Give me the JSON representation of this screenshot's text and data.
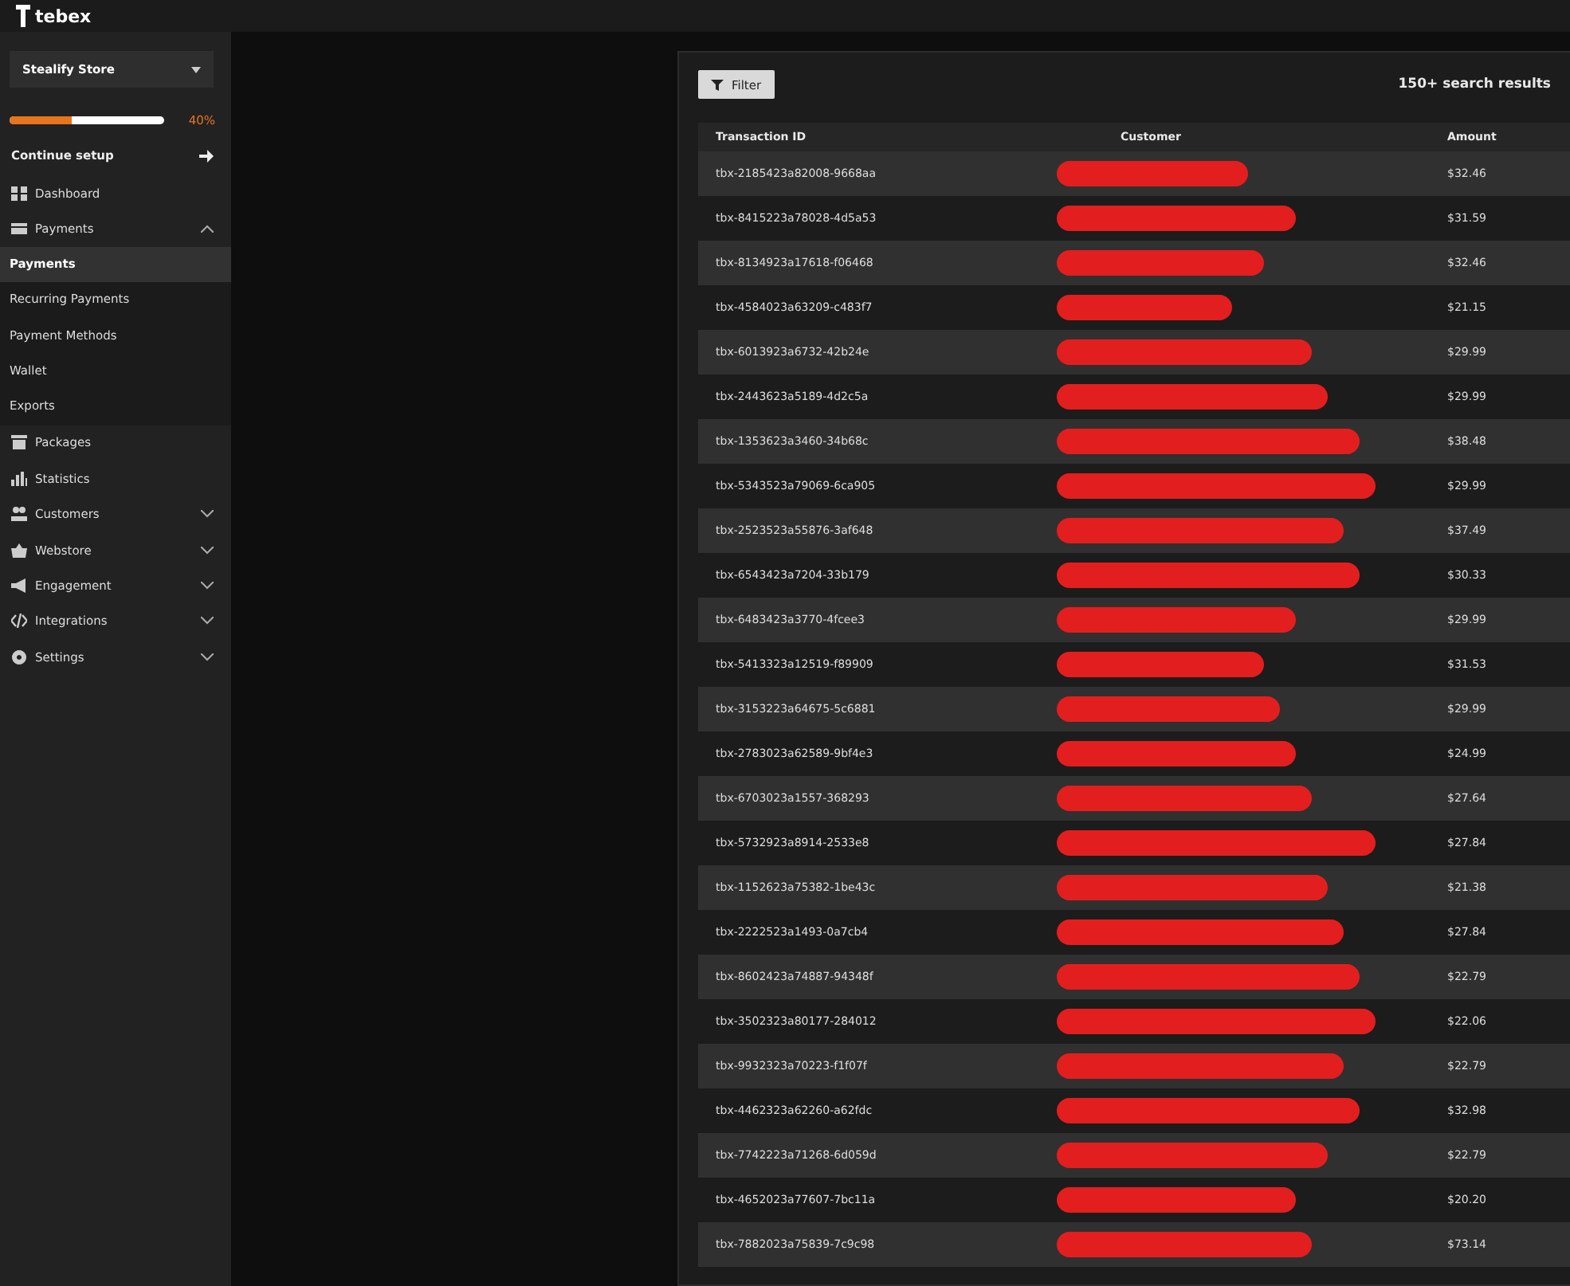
{
  "topbar": {
    "logo_text": "tebex"
  },
  "sidebar": {
    "store_selector": {
      "value": "Stealify Store"
    },
    "setup": {
      "level": 0.4,
      "percent": "40%",
      "label": "Continue setup"
    },
    "items": [
      {
        "label": "Dashboard"
      },
      {
        "label": "Payments",
        "expanded": true,
        "children": [
          {
            "label": "Payments",
            "selected": true
          },
          {
            "label": "Recurring Payments",
            "selected": false
          },
          {
            "label": "Payment Methods",
            "selected": false
          },
          {
            "label": "Wallet",
            "selected": false
          },
          {
            "label": "Exports",
            "selected": false
          }
        ]
      },
      {
        "label": "Packages"
      },
      {
        "label": "Statistics"
      },
      {
        "label": "Customers",
        "expanded": false
      },
      {
        "label": "Webstore",
        "expanded": false
      },
      {
        "label": "Engagement",
        "expanded": false
      },
      {
        "label": "Integrations",
        "expanded": false
      },
      {
        "label": "Settings",
        "expanded": false
      }
    ]
  },
  "panel": {
    "filter_button": "Filter",
    "result_count": "150+ search results",
    "table": {
      "columns": [
        "Transaction ID",
        "Customer",
        "Amount"
      ],
      "rows": [
        {
          "transaction_id": "tbx-2185423a82008-9668aa",
          "amount": "$32.46"
        },
        {
          "transaction_id": "tbx-8415223a78028-4d5a53",
          "amount": "$31.59"
        },
        {
          "transaction_id": "tbx-8134923a17618-f06468",
          "amount": "$32.46"
        },
        {
          "transaction_id": "tbx-4584023a63209-c483f7",
          "amount": "$21.15"
        },
        {
          "transaction_id": "tbx-6013923a6732-42b24e",
          "amount": "$29.99"
        },
        {
          "transaction_id": "tbx-2443623a5189-4d2c5a",
          "amount": "$29.99"
        },
        {
          "transaction_id": "tbx-1353623a3460-34b68c",
          "amount": "$38.48"
        },
        {
          "transaction_id": "tbx-5343523a79069-6ca905",
          "amount": "$29.99"
        },
        {
          "transaction_id": "tbx-2523523a55876-3af648",
          "amount": "$37.49"
        },
        {
          "transaction_id": "tbx-6543423a7204-33b179",
          "amount": "$30.33"
        },
        {
          "transaction_id": "tbx-6483423a3770-4fcee3",
          "amount": "$29.99"
        },
        {
          "transaction_id": "tbx-5413323a12519-f89909",
          "amount": "$31.53"
        },
        {
          "transaction_id": "tbx-3153223a64675-5c6881",
          "amount": "$29.99"
        },
        {
          "transaction_id": "tbx-2783023a62589-9bf4e3",
          "amount": "$24.99"
        },
        {
          "transaction_id": "tbx-6703023a1557-368293",
          "amount": "$27.64"
        },
        {
          "transaction_id": "tbx-5732923a8914-2533e8",
          "amount": "$27.84"
        },
        {
          "transaction_id": "tbx-1152623a75382-1be43c",
          "amount": "$21.38"
        },
        {
          "transaction_id": "tbx-2222523a1493-0a7cb4",
          "amount": "$27.84"
        },
        {
          "transaction_id": "tbx-8602423a74887-94348f",
          "amount": "$22.79"
        },
        {
          "transaction_id": "tbx-3502323a80177-284012",
          "amount": "$22.06"
        },
        {
          "transaction_id": "tbx-9932323a70223-f1f07f",
          "amount": "$22.79"
        },
        {
          "transaction_id": "tbx-4462323a62260-a62fdc",
          "amount": "$32.98"
        },
        {
          "transaction_id": "tbx-7742223a71268-6d059d",
          "amount": "$22.79"
        },
        {
          "transaction_id": "tbx-4652023a77607-7bc11a",
          "amount": "$20.20"
        },
        {
          "transaction_id": "tbx-7882023a75839-7c9c98",
          "amount": "$73.14"
        }
      ]
    }
  }
}
